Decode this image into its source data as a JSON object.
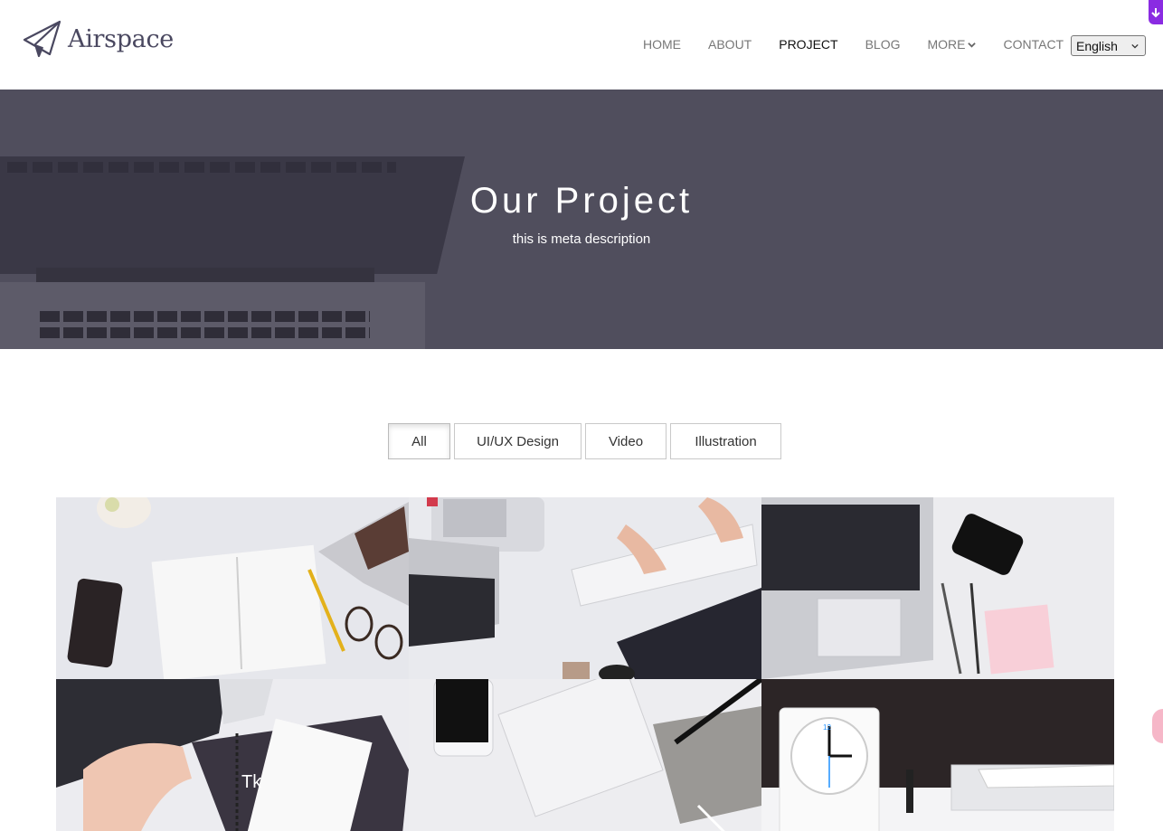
{
  "header": {
    "logo_text": "Airspace",
    "nav": [
      {
        "label": "HOME",
        "active": false
      },
      {
        "label": "ABOUT",
        "active": false
      },
      {
        "label": "PROJECT",
        "active": true
      },
      {
        "label": "BLOG",
        "active": false
      },
      {
        "label": "MORE",
        "active": false,
        "has_dropdown": true
      },
      {
        "label": "CONTACT",
        "active": false
      }
    ],
    "language_select": {
      "selected": "English"
    }
  },
  "hero": {
    "title": "Our Project",
    "subtitle": "this is meta description"
  },
  "filters": [
    {
      "label": "All",
      "active": true
    },
    {
      "label": "UI/UX Design",
      "active": false
    },
    {
      "label": "Video",
      "active": false
    },
    {
      "label": "Illustration",
      "active": false
    }
  ],
  "projects": [
    {
      "image": "notebook-phone-glasses-photo"
    },
    {
      "image": "hands-keyboard-laptop-photo"
    },
    {
      "image": "laptop-phone-pens-photo"
    },
    {
      "image": "hand-laptop-notebook-photo"
    },
    {
      "image": "phone-keyboard-pen-photo"
    },
    {
      "image": "alarm-clock-desk-photo"
    }
  ],
  "colors": {
    "hero_bg": "#504e5d",
    "accent_badge": "#8a2be2",
    "logo": "#4a4860"
  }
}
